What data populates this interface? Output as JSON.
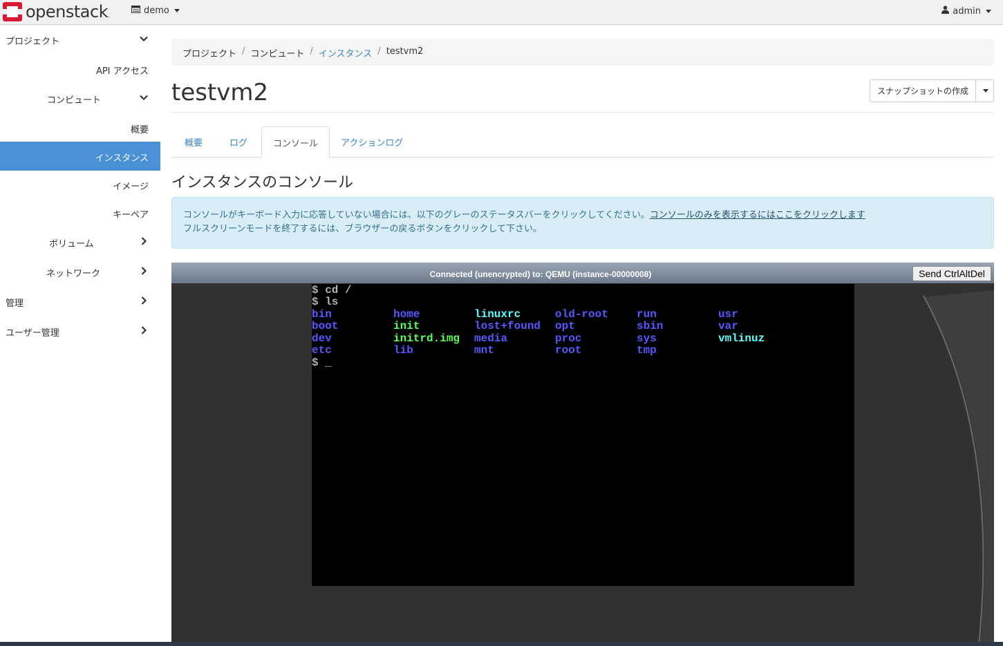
{
  "navbar": {
    "brand": "openstack",
    "brand_dot": ".",
    "project": "demo",
    "user": "admin"
  },
  "sidebar": {
    "project": "プロジェクト",
    "api_access": "API アクセス",
    "compute": "コンピュート",
    "overview": "概要",
    "instances": "インスタンス",
    "images": "イメージ",
    "keypairs": "キーペア",
    "volumes": "ボリューム",
    "network": "ネットワーク",
    "admin": "管理",
    "identity": "ユーザー管理"
  },
  "breadcrumb": {
    "items": [
      "プロジェクト",
      "コンピュート",
      "インスタンス",
      "testvm2"
    ],
    "sep": "/"
  },
  "page": {
    "title": "testvm2",
    "snapshot_button": "スナップショットの作成"
  },
  "tabs": [
    "概要",
    "ログ",
    "コンソール",
    "アクションログ"
  ],
  "console_section": {
    "title": "インスタンスのコンソール",
    "alert_line1": "コンソールがキーボード入力に応答していない場合には、以下のグレーのステータスバーをクリックしてください。",
    "alert_link": "コンソールのみを表示するにはここをクリックします",
    "alert_line2": "フルスクリーンモードを終了するには、ブラウザーの戻るボタンをクリックして下さい。"
  },
  "console": {
    "status": "Connected (unencrypted) to: QEMU (instance-00000008)",
    "cad_button": "Send CtrlAltDel",
    "lines": [
      "$ cd /",
      "$ ls"
    ],
    "prompt": "$ _",
    "listing": [
      [
        "bin",
        "home",
        "linuxrc",
        "old-root",
        "run",
        "usr"
      ],
      [
        "boot",
        "init",
        "lost+found",
        "opt",
        "sbin",
        "var"
      ],
      [
        "dev",
        "initrd.img",
        "media",
        "proc",
        "sys",
        "vmlinuz"
      ],
      [
        "etc",
        "lib",
        "mnt",
        "root",
        "tmp",
        ""
      ]
    ],
    "colors": {
      "directory": "#5757ff",
      "executable": "#57ff57",
      "symlink": "#57ffff",
      "text": "#b3b3b3"
    }
  }
}
